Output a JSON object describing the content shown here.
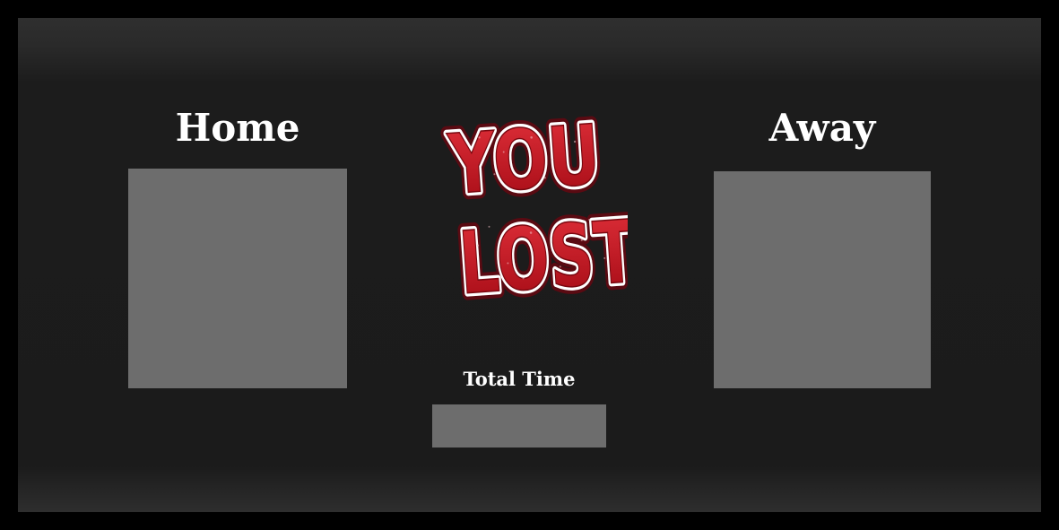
{
  "home": {
    "title": "Home"
  },
  "away": {
    "title": "Away"
  },
  "result": {
    "line1": "YOU",
    "line2": "LOST",
    "fill_color": "#c8101e",
    "outline_color": "#ffffff",
    "glow_color": "#5a0a12"
  },
  "timer": {
    "title": "Total Time"
  },
  "colors": {
    "background": "#1b1b1b",
    "border": "#000000",
    "panel": "#6d6d6d",
    "text": "#ffffff"
  }
}
